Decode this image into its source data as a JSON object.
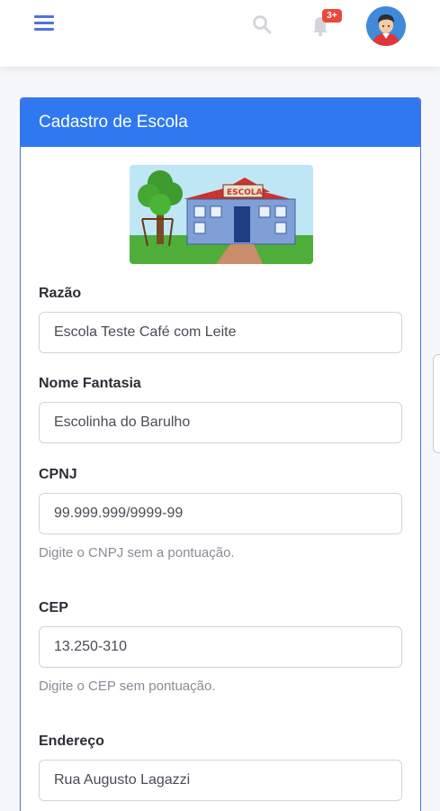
{
  "topbar": {
    "menu_icon": "hamburger-icon",
    "search_icon": "search-icon",
    "bell_icon": "bell-icon",
    "notification_count": "3+",
    "avatar_icon": "user-avatar"
  },
  "card": {
    "title": "Cadastro de Escola",
    "illustration_text": "ESCOLA"
  },
  "form": {
    "razao": {
      "label": "Razão",
      "value": "Escola Teste Café com Leite"
    },
    "nome_fantasia": {
      "label": "Nome Fantasia",
      "value": "Escolinha do Barulho"
    },
    "cnpj": {
      "label": "CPNJ",
      "value": "99.999.999/9999-99",
      "help": "Digite o CNPJ sem a pontuação."
    },
    "cep": {
      "label": "CEP",
      "value": "13.250-310",
      "help": "Digite o CEP sem pontuação."
    },
    "endereco": {
      "label": "Endereço",
      "value": "Rua Augusto Lagazzi"
    }
  },
  "colors": {
    "accent": "#4e73df",
    "header": "#2f78f0",
    "badge": "#e74a3b"
  }
}
